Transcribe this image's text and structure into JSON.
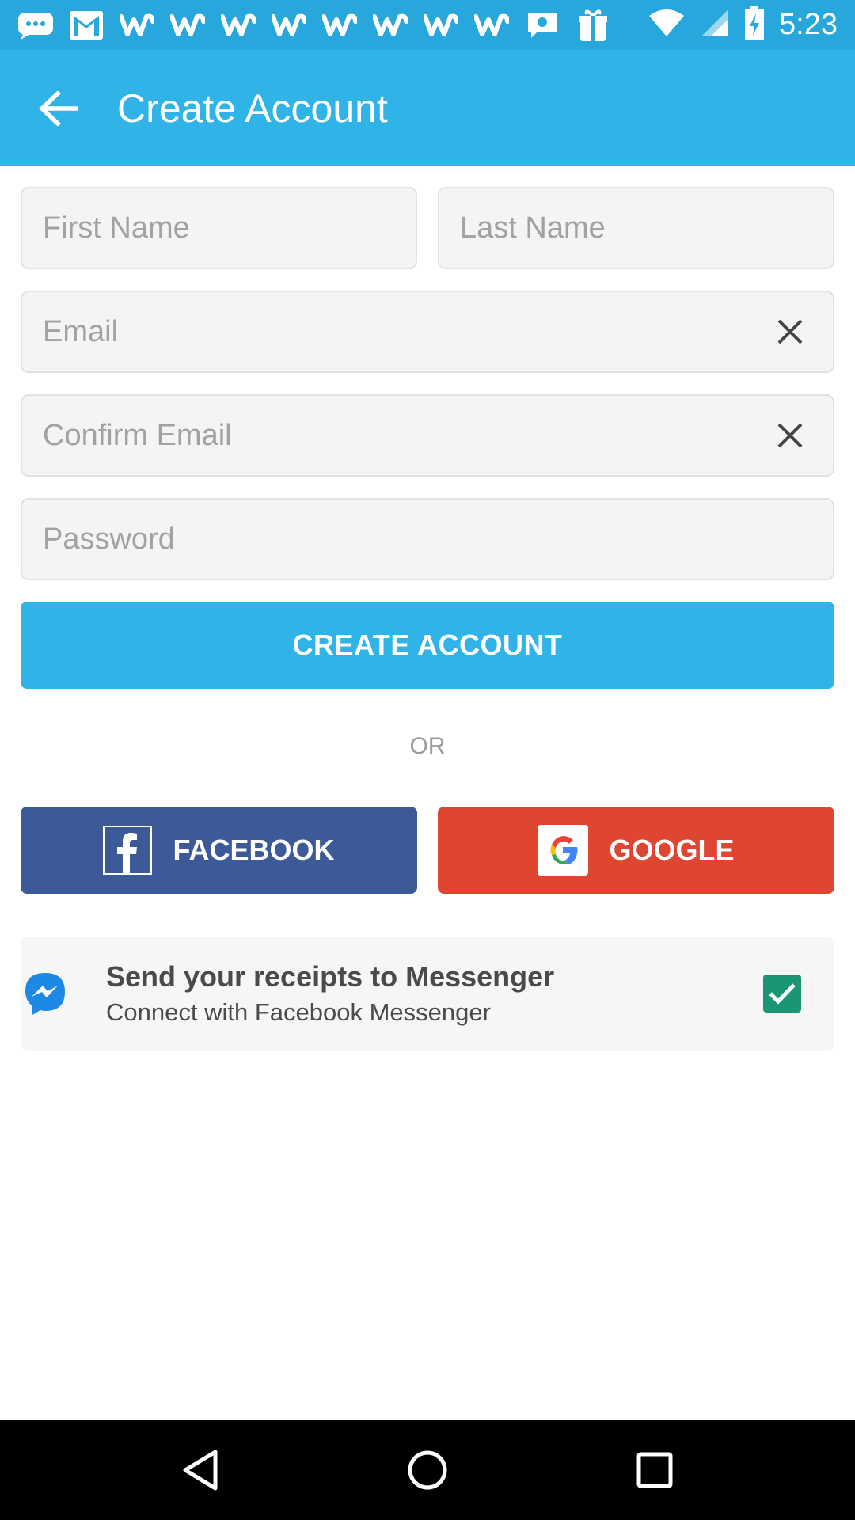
{
  "status_bar": {
    "time": "5:23",
    "notification_icons": [
      "chat-bubble-icon",
      "gmail-icon",
      "w-app-icon",
      "w-app-icon",
      "w-app-icon",
      "w-app-icon",
      "w-app-icon",
      "w-app-icon",
      "w-app-icon",
      "w-app-icon",
      "hangouts-icon",
      "gift-box-icon"
    ],
    "system_icons": [
      "wifi-icon",
      "cellular-signal-icon",
      "battery-charging-icon"
    ]
  },
  "app_bar": {
    "title": "Create Account",
    "back_icon": "arrow-back-icon"
  },
  "form": {
    "first_name": {
      "placeholder": "First Name",
      "value": ""
    },
    "last_name": {
      "placeholder": "Last Name",
      "value": ""
    },
    "email": {
      "placeholder": "Email",
      "value": ""
    },
    "confirm_email": {
      "placeholder": "Confirm Email",
      "value": ""
    },
    "password": {
      "placeholder": "Password",
      "value": ""
    },
    "submit_label": "CREATE ACCOUNT"
  },
  "divider_text": "OR",
  "social": {
    "facebook_label": "FACEBOOK",
    "google_label": "GOOGLE"
  },
  "messenger": {
    "title": "Send your receipts to Messenger",
    "subtitle": "Connect with Facebook Messenger",
    "checked": true
  },
  "colors": {
    "status_bar": "#27a7dc",
    "app_bar": "#30b4e8",
    "facebook": "#3d5a98",
    "google": "#de4632",
    "checkbox": "#1a9676"
  },
  "nav_bar": [
    "back-triangle-icon",
    "home-circle-icon",
    "recents-square-icon"
  ]
}
